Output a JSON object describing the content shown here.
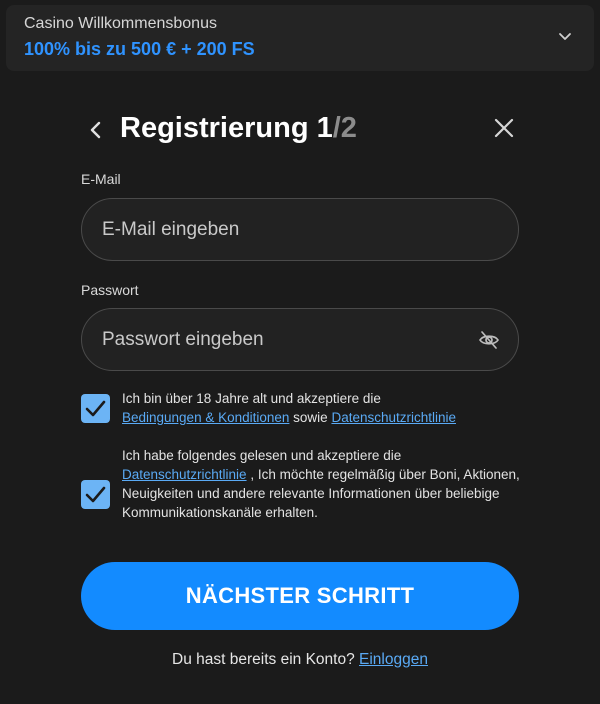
{
  "bonus": {
    "title": "Casino Willkommensbonus",
    "offer": "100% bis zu 500 € + 200 FS",
    "offer_color": "#2f93ff",
    "chevron_icon": "chevron-down-icon"
  },
  "header": {
    "title": "Registrierung 1",
    "step_total": "/2",
    "back_icon": "chevron-left-icon",
    "close_icon": "close-icon"
  },
  "email": {
    "label": "E-Mail",
    "placeholder": "E-Mail eingeben",
    "value": ""
  },
  "password": {
    "label": "Passwort",
    "placeholder": "Passwort eingeben",
    "value": "",
    "toggle_icon": "eye-off-icon"
  },
  "consents": [
    {
      "checked": true,
      "text_before": "Ich bin über 18 Jahre alt und akzeptiere die",
      "link1": "Bedingungen & Konditionen",
      "text_middle": "sowie",
      "link2": "Datenschutzrichtlinie"
    },
    {
      "checked": true,
      "text_before": "Ich habe folgendes gelesen und akzeptiere die",
      "link1": "Datenschutzrichtlinie",
      "text_after": ", Ich möchte regelmäßig über Boni, Aktionen, Neuigkeiten und andere relevante Informationen über beliebige Kommunikationskanäle erhalten."
    }
  ],
  "next_button": {
    "label": "NÄCHSTER SCHRITT",
    "color": "#138bff"
  },
  "login": {
    "prompt": "Du hast bereits ein Konto?",
    "link": "Einloggen"
  },
  "colors": {
    "background": "#1b1b1b",
    "checkbox": "#6cb4f5",
    "link": "#5aaaf5"
  }
}
